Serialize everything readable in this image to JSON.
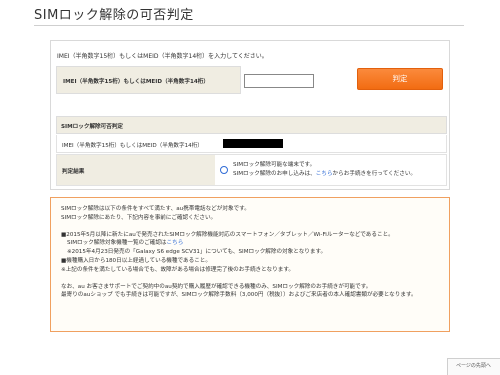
{
  "page": {
    "title": "SIMロック解除の可否判定"
  },
  "form": {
    "instruction": "IMEI（半角数字15桁）もしくはMEID（半角数字14桁）を入力してください。",
    "imei_label": "IMEI（半角数字15桁）もしくはMEID（半角数字14桁）",
    "imei_value": "",
    "judge_button": "判定"
  },
  "result": {
    "header": "SIMロック解除可否判定",
    "imei_row_label": "IMEI（半角数字15桁）もしくはMEID（半角数字14桁）",
    "judgement_label": "判定結果",
    "judgement_line1": "SIMロック解除可能な端末です。",
    "judgement_line2_prefix": "SIMロック解除のお申し込みは、",
    "judgement_link": "こちら",
    "judgement_line2_suffix": "からお手続きを行ってください。"
  },
  "notice": {
    "line1": "SIMロック解除は以下の条件をすべて満たす、au携帯電話などが対象です。",
    "line2": "SIMロック解除にあたり、下記内容を事前にご確認ください。",
    "bullet1": "■2015年5月以降に新たにauで発売されたSIMロック解除機能対応のスマートフォン／タブレット／Wi-Fiルーターなどであること。",
    "bullet1_sub_prefix": "SIMロック解除対象機種一覧のご確認は",
    "bullet1_sub_link": "こちら",
    "bullet1_note": "※2015年4月23日発売の「Galaxy S6 edge SCV31」についても、SIMロック解除の対象となります。",
    "bullet2": "■機種購入日から180日以上経過している機種であること。",
    "bullet2_note": "※上記の条件を満たしている場合でも、故障がある場合は修理完了後のお手続きとなります。",
    "para2_line1": "なお、au お客さまサポートでご契約中のau契約で購入履歴が確認できる機種のみ、SIMロック解除のお手続きが可能です。",
    "para2_line2": "最寄りのauショップ でも手続きは可能ですが、SIMロック解除手数料（3,000円（税抜））およびご来店者の本人確認書類が必要となります。"
  },
  "footer": {
    "page_top": "ページの先頭へ"
  },
  "colors": {
    "accent": "#f26c12",
    "link": "#2f6bd6",
    "label_bg": "#f0ede2"
  }
}
